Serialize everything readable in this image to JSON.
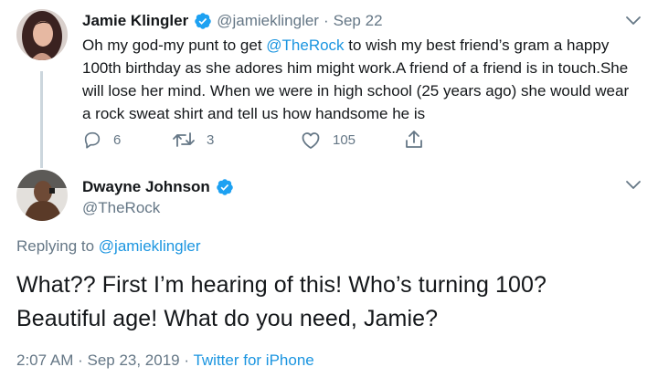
{
  "tweet1": {
    "name": "Jamie Klingler",
    "handle": "@jamieklingler",
    "separator": "·",
    "date": "Sep 22",
    "text_part1": "Oh my god-my punt to get ",
    "mention": "@TheRock",
    "text_part2": " to wish my best friend’s gram a happy 100th birthday as she adores him might work.A friend of a friend is in touch.She will lose her mind. When we were in high school (25 years ago) she would wear a rock sweat shirt and tell us how handsome he is",
    "replies": "6",
    "retweets": "3",
    "likes": "105"
  },
  "tweet2": {
    "name": "Dwayne Johnson",
    "handle": "@TheRock",
    "replying_prefix": "Replying to ",
    "replying_to": "@jamieklingler",
    "text_line1": "What?? First I’m hearing of this! Who’s turning 100?",
    "text_line2": "Beautiful age! What do you need, Jamie?",
    "time": "2:07 AM",
    "separator1": " · ",
    "date": "Sep 23, 2019",
    "separator2": " · ",
    "source": "Twitter for iPhone"
  },
  "colors": {
    "link": "#1b95e0",
    "verified": "#1da1f2",
    "secondary_text": "#657786",
    "thread_line": "#ccd6dd"
  },
  "icons": {
    "reply": "reply-icon",
    "retweet": "retweet-icon",
    "like": "heart-icon",
    "share": "share-icon",
    "verified": "verified-badge-icon",
    "more": "chevron-down-icon"
  }
}
